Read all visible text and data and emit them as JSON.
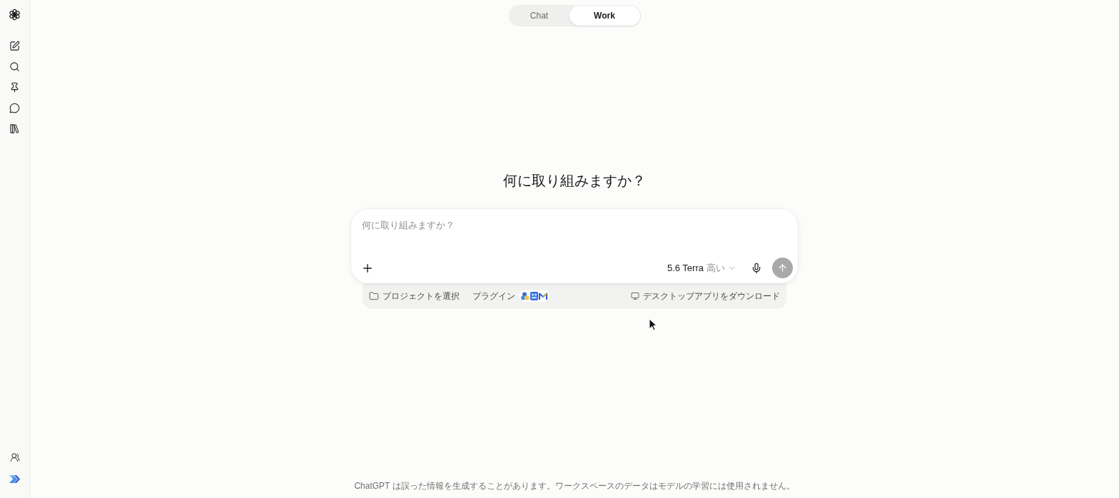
{
  "mode_switch": [
    {
      "label": "Chat",
      "selected": false
    },
    {
      "label": "Work",
      "selected": true
    }
  ],
  "heading": "何に取り組みますか？",
  "composer": {
    "placeholder": "何に取り組みますか？",
    "model": "5.6 Terra",
    "effort": "高い"
  },
  "composer_footer": {
    "project": "プロジェクトを選択",
    "plugins": "プラグイン",
    "download": "デスクトップアプリをダウンロード"
  },
  "disclaimer": "ChatGPT は誤った情報を生成することがあります。ワークスペースのデータはモデルの学習には使用されません。"
}
